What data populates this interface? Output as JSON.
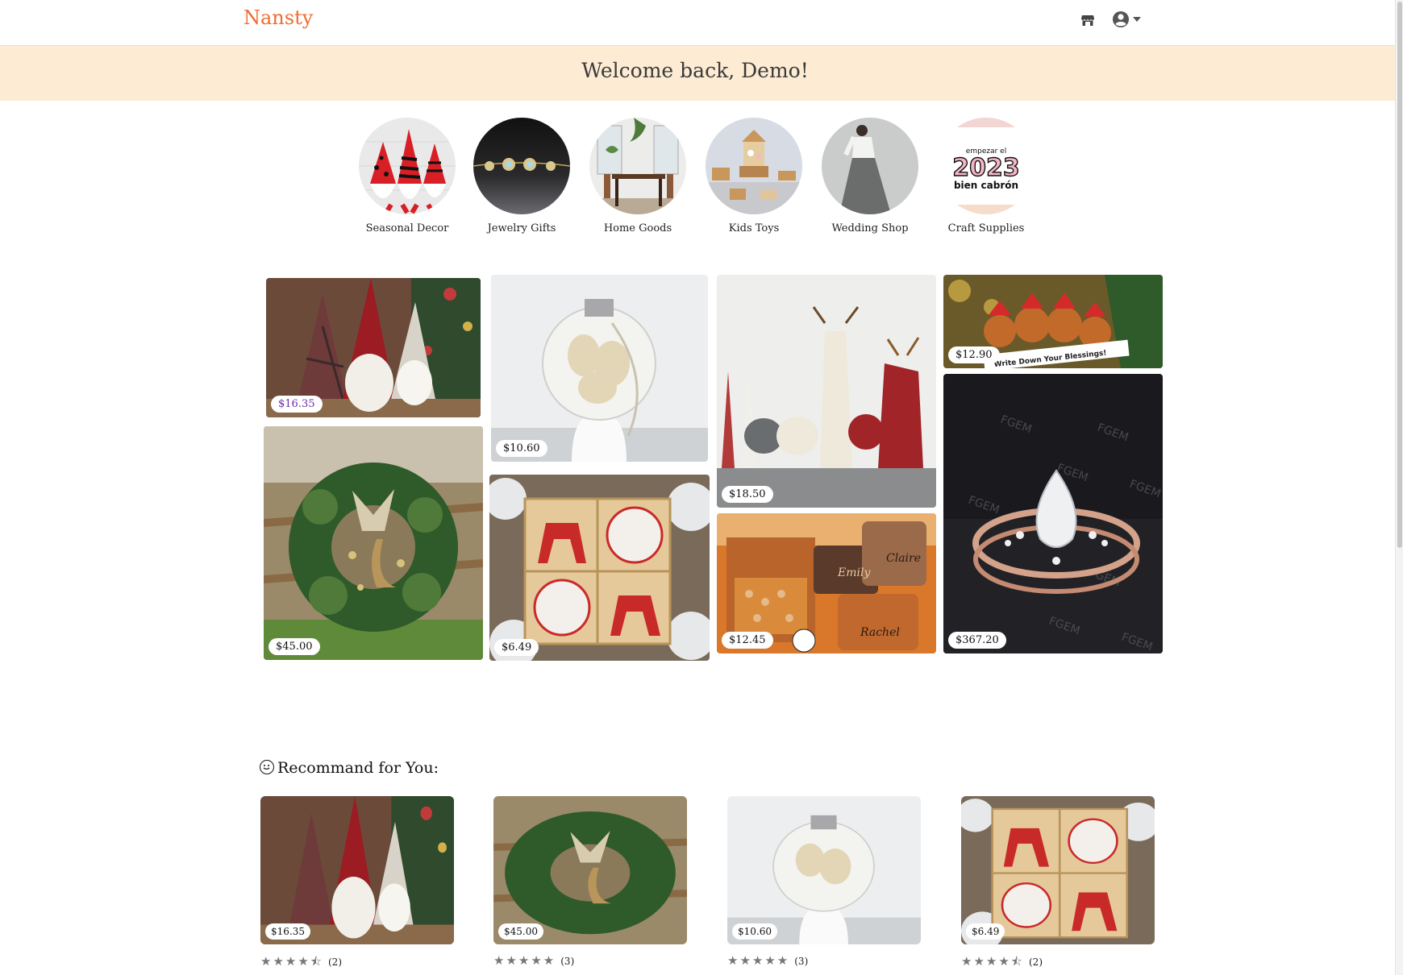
{
  "header": {
    "logo": "Nansty"
  },
  "welcome": {
    "text": "Welcome back, Demo!"
  },
  "categories": [
    {
      "label": "Seasonal Decor"
    },
    {
      "label": "Jewelry Gifts"
    },
    {
      "label": "Home Goods"
    },
    {
      "label": "Kids Toys"
    },
    {
      "label": "Wedding Shop"
    },
    {
      "label": "Craft Supplies",
      "image_text": "empezar el 2023 bien cabrón"
    }
  ],
  "featured": [
    {
      "price": "$16.35",
      "subject": "gnomes"
    },
    {
      "price": "$45.00",
      "subject": "wreath"
    },
    {
      "price": "$10.60",
      "subject": "ornament"
    },
    {
      "price": "$6.49",
      "subject": "reindeer ornaments"
    },
    {
      "price": "$18.50",
      "subject": "felt reindeer"
    },
    {
      "price": "$12.45",
      "subject": "jewelry boxes",
      "image_text": [
        "Emily",
        "Claire",
        "Rachel"
      ]
    },
    {
      "price": "$12.90",
      "subject": "reindeer family ornament",
      "image_text": "Write Down Your Blessings!"
    },
    {
      "price": "$367.20",
      "subject": "rose gold ring",
      "image_text": "FGEM"
    }
  ],
  "recommend": {
    "title": "Recommand for You:",
    "items": [
      {
        "price": "$16.35",
        "stars": 4.5,
        "count": "(2)"
      },
      {
        "price": "$45.00",
        "stars": 5,
        "count": "(3)"
      },
      {
        "price": "$10.60",
        "stars": 5,
        "count": "(3)"
      },
      {
        "price": "$6.49",
        "stars": 4.5,
        "count": "(2)"
      }
    ]
  },
  "colors": {
    "brand": "#ef6c2f",
    "banner": "#fdebd4",
    "price_highlight": "#6a2fa8"
  }
}
